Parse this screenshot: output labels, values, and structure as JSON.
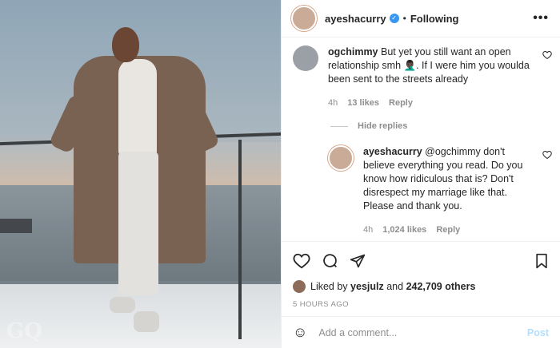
{
  "post": {
    "author": "ayeshacurry",
    "follow_status": "Following",
    "dot": "•",
    "more": "•••"
  },
  "comments": [
    {
      "user": "ogchimmy",
      "text": "But yet you still want an open relationship smh 🤦🏿‍♂️. If I were him you woulda been sent to the streets already",
      "time": "4h",
      "likes": "13 likes",
      "reply_label": "Reply"
    }
  ],
  "hide_replies": "Hide replies",
  "replies": [
    {
      "user": "ayeshacurry",
      "text": "@ogchimmy don't believe everything you read. Do you know how ridiculous that is? Don't disrespect my marriage like that. Please and thank you.",
      "time": "4h",
      "likes": "1,024 likes",
      "reply_label": "Reply"
    }
  ],
  "likes": {
    "prefix": "Liked by",
    "user": "yesjulz",
    "conj": "and",
    "others": "242,709 others"
  },
  "timeago": "5 HOURS AGO",
  "add_comment": {
    "placeholder": "Add a comment...",
    "post_label": "Post"
  },
  "icons": {
    "verified": "verified-badge-icon",
    "heart": "heart-icon",
    "comment": "comment-icon",
    "share": "share-icon",
    "bookmark": "bookmark-icon",
    "emoji": "emoji-icon"
  },
  "colors": {
    "verified": "#3897f0",
    "muted": "#8e8e8e",
    "post_disabled": "#b2dffc"
  },
  "watermark": "GQ"
}
